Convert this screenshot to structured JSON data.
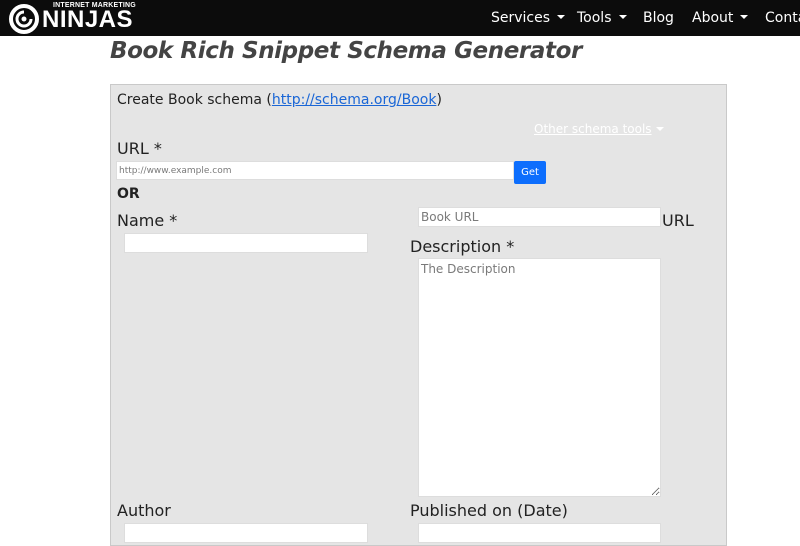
{
  "brand": {
    "top_text": "INTERNET MARKETING",
    "main_text": "NINJAS"
  },
  "nav": {
    "items": [
      {
        "label": "Services"
      },
      {
        "label": "Tools"
      },
      {
        "label": "Blog"
      },
      {
        "label": "About"
      },
      {
        "label": "Conta"
      }
    ]
  },
  "page": {
    "title": "Book Rich Snippet Schema Generator"
  },
  "form": {
    "heading_prefix": "Create Book schema (",
    "heading_link": "http://schema.org/Book",
    "heading_suffix": ")",
    "other_tools": "Other schema tools",
    "url_label": "URL *",
    "url_placeholder": "http://www.example.com",
    "get_button": "Get",
    "or_text": "OR",
    "name_label": "Name *",
    "name_value": "",
    "book_url_placeholder": "Book URL",
    "book_url_label": "URL",
    "description_label": "Description *",
    "description_placeholder": "The Description",
    "author_label": "Author",
    "published_label": "Published on (Date)"
  },
  "colors": {
    "topbar": "#0c0c0c",
    "panel": "#e5e5e5",
    "link": "#1a66d6",
    "primary_button": "#0d6efd"
  }
}
